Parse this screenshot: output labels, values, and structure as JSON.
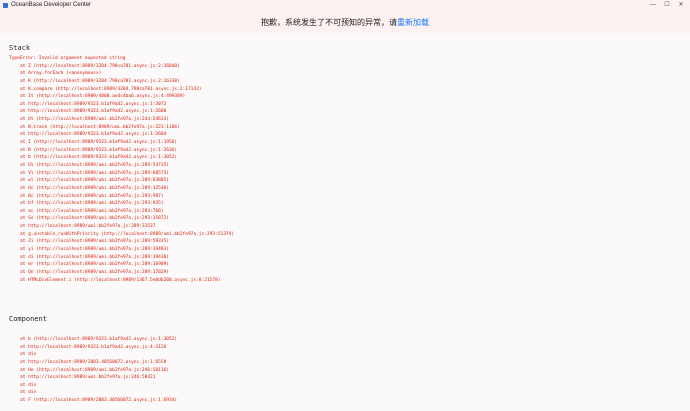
{
  "window": {
    "title": "OceanBase Developer Center",
    "controls": [
      "—",
      "☐",
      "✕"
    ]
  },
  "banner": {
    "message": "抱歉，系统发生了不可预知的异常，请",
    "reload_label": "重新加载"
  },
  "stack": {
    "heading": "Stack",
    "first_line": "TypeError: Invalid argument expected string",
    "frames": [
      "at Z (http://localhost:8989/3204.798ca701.async.js:2:16840)",
      "at Array.forEach (<anonymous>)",
      "at K (http://localhost:8989/3204.798ca701.async.js:2:16338)",
      "at K.compare (http://localhost:8989/3204.798ca701.async.js:2:17142)",
      "at It (http://localhost:8989/4800.ae4c4ba6.async.js:4:499389)",
      "at http://localhost:8989/9323.b1af9a42.async.js:1:3072",
      "at http://localhost:8989/9323.b1af9a42.async.js:1:2688",
      "at Ot (http://localhost:8989/umi.bb2fe97a.js:244:24633)",
      "at N.track (http://localhost:8989/umi.bb2fe97a.js:223:1186)",
      "at http://localhost:8989/9323.b1af9a42.async.js:1:2604",
      "at I (http://localhost:8989/9323.b1af9a42.async.js:1:1956)",
      "at B (http://localhost:8989/9323.b1af9a42.async.js:1:2636)",
      "at b (http://localhost:8989/9323.b1af9a42.async.js:1:3052)",
      "at Ul (http://localhost:8989/umi.bb2fe97a.js:289:54735)",
      "at Vl (http://localhost:8989/umi.bb2fe97a.js:289:68573)",
      "at wl (http://localhost:8989/umi.bb2fe97a.js:289:63885)",
      "at Hc (http://localhost:8989/umi.bb2fe97a.js:289:12546)",
      "at Bc (http://localhost:8989/umi.bb2fe97a.js:293:987)",
      "at bf (http://localhost:8989/umi.bb2fe97a.js:293:935)",
      "at ac (http://localhost:8989/umi.bb2fe97a.js:293:766)",
      "at Ss (http://localhost:8989/umi.bb2fe97a.js:293:35872)",
      "at http://localhost:8989/umi.bb2fe97a.js:289:33537",
      "at g.unstable_runWithPriority (http://localhost:8989/umi.bb2fe97a.js:293:51374)",
      "at Zi (http://localhost:8989/umi.bb2fe97a.js:289:59335)",
      "at yi (http://localhost:8989/umi.bb2fe97a.js:289:39483)",
      "at di (http://localhost:8989/umi.bb2fe97a.js:289:39438)",
      "at mr (http://localhost:8989/umi.bb2fe97a.js:289:16989)",
      "at Qn (http://localhost:8989/umi.bb2fe97a.js:289:17029)",
      "at HTMLDivElement.i (http://localhost:8989/1367.5e0db200.async.js:8:21578)"
    ]
  },
  "component": {
    "heading": "Component",
    "frames": [
      "at b (http://localhost:8989/9323.b1af9a42.async.js:1:3052)",
      "at http://localhost:8989/9323.b1af9a42.async.js:4:3126",
      "at div",
      "at http://localhost:8989/2083.40560072.async.js:1:6558",
      "at He (http://localhost:8989/umi.bb2fe97a.js:246:50116)",
      "at http://localhost:8989/umi.bb2fe97a.js:246:50421",
      "at div",
      "at div",
      "at F (http://localhost:8989/2083.40560072.async.js:1:6934)"
    ]
  },
  "colors": {
    "error_text": "#d81e06",
    "banner_bg": "#fdf2f2",
    "link": "#1677ff"
  }
}
